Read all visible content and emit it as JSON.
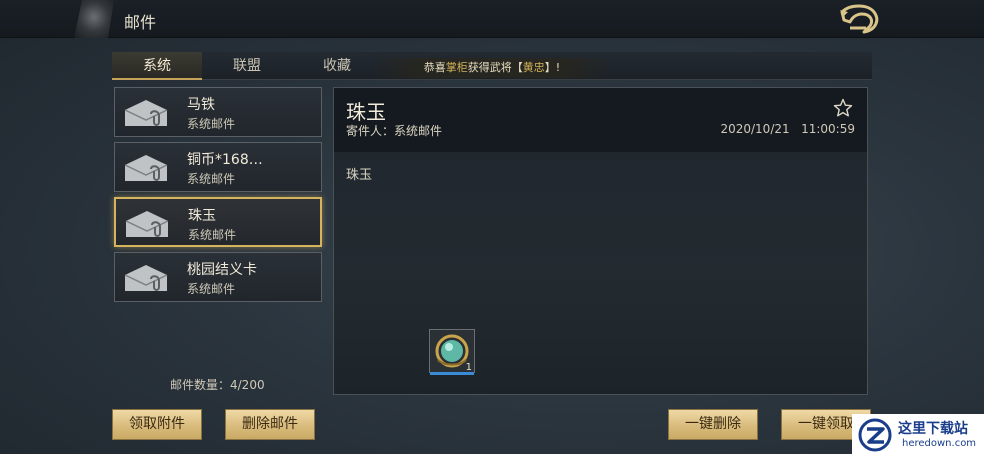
{
  "header": {
    "title": "邮件",
    "back_icon": "dragon-back-icon"
  },
  "tabs": [
    {
      "label": "系统",
      "active": true
    },
    {
      "label": "联盟",
      "active": false
    },
    {
      "label": "收藏",
      "active": false
    }
  ],
  "ticker": {
    "prefix": "恭喜",
    "name": "掌柜",
    "middle": "获得武将【",
    "general": "黄忠",
    "suffix": "】!"
  },
  "mail_list": [
    {
      "title": "马铁",
      "sender": "系统邮件",
      "selected": false
    },
    {
      "title": "铜币*168…",
      "sender": "系统邮件",
      "selected": false
    },
    {
      "title": "珠玉",
      "sender": "系统邮件",
      "selected": true
    },
    {
      "title": "桃园结义卡",
      "sender": "系统邮件",
      "selected": false
    }
  ],
  "mail_count": "邮件数量：4/200",
  "detail": {
    "title": "珠玉",
    "sender": "寄件人：系统邮件",
    "date": "2020/10/21",
    "time": "11:00:59",
    "body": "珠玉",
    "attachment": {
      "icon": "jade-orb-icon",
      "count": "1"
    }
  },
  "buttons": {
    "claim_attachment": "领取附件",
    "delete_mail": "删除邮件",
    "delete_all": "一键删除",
    "claim_all": "一键领取"
  },
  "watermark": {
    "text": "这里下载站",
    "url": "heredown.com"
  },
  "colors": {
    "accent_gold": "#d6b45e",
    "button_gold": "#e3c98e",
    "attachment_bar": "#3a8ad6"
  }
}
